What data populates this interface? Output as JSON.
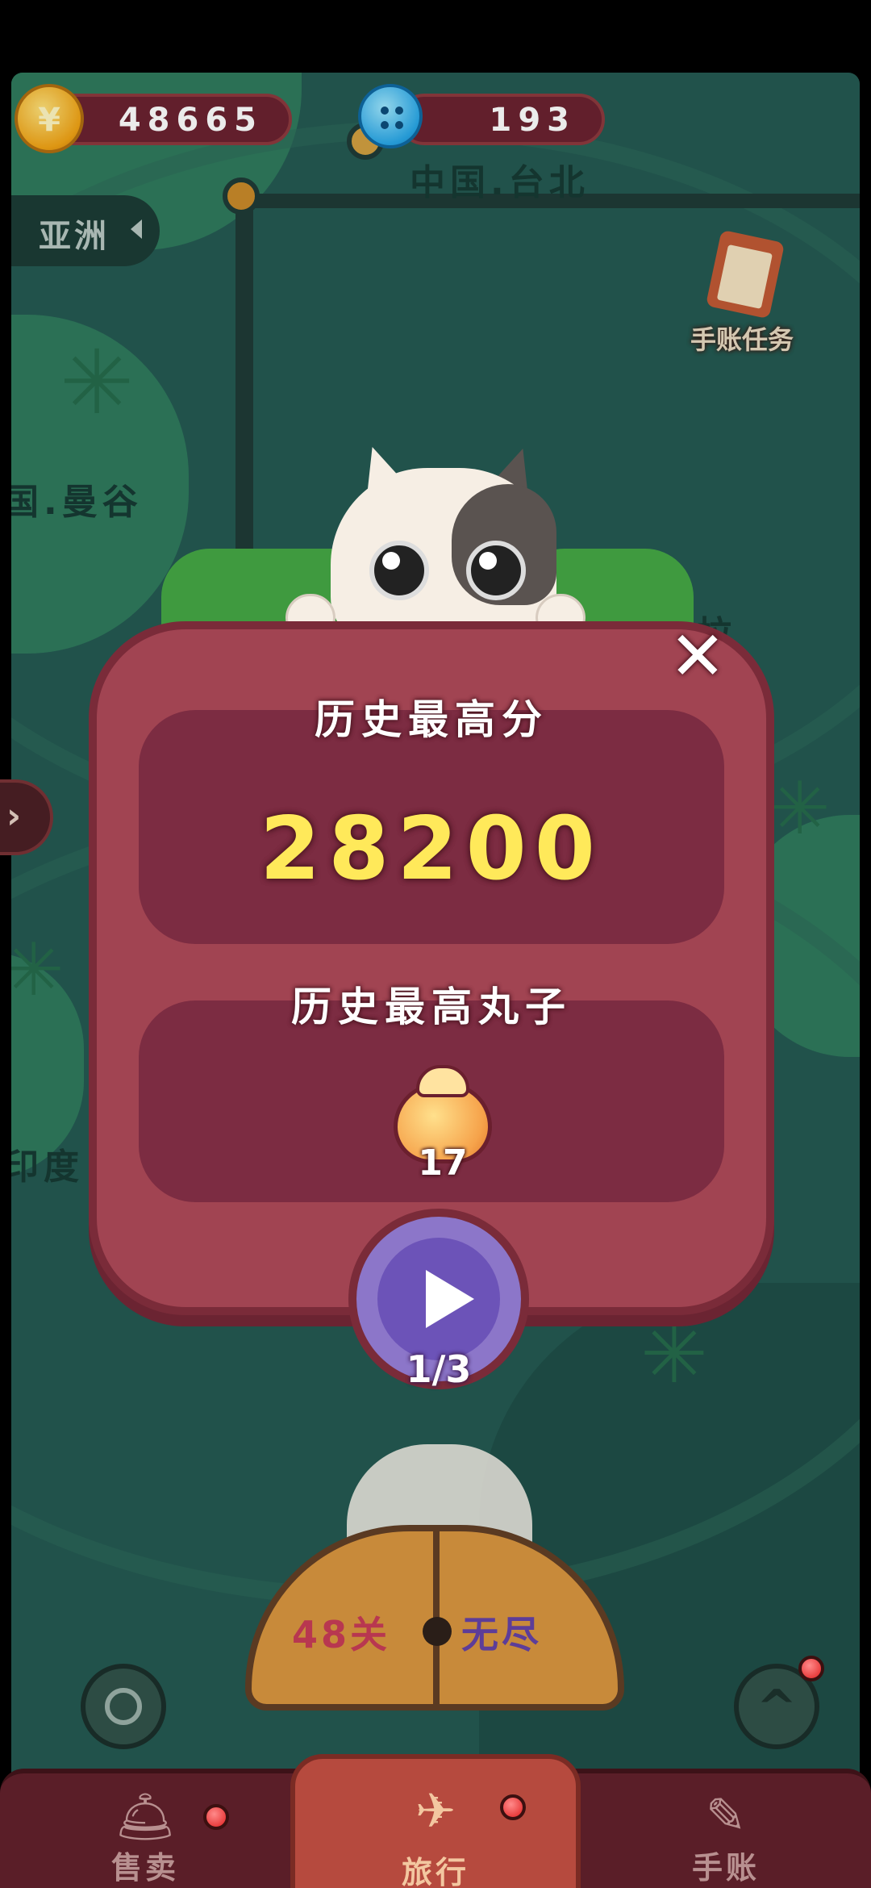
{
  "top_bar": {
    "coins": "48665",
    "buttons": "193"
  },
  "map": {
    "region": "亚洲",
    "labels": {
      "taipei": "中国.台北",
      "bangkok": "国.曼谷",
      "manila": "尼拉",
      "india": "印度"
    },
    "journal_task": "手账任务"
  },
  "modal": {
    "high_score_title": "历史最高分",
    "high_score": "28200",
    "high_dumpling_title": "历史最高丸子",
    "high_dumpling_count": "17",
    "plays": "1/3",
    "close_icon": "close-icon"
  },
  "mode_selector": {
    "level": "48关",
    "endless": "无尽"
  },
  "bottom_nav": {
    "items": [
      {
        "label": "售卖",
        "icon": "bell-icon"
      },
      {
        "label": "旅行",
        "icon": "travel-icon"
      },
      {
        "label": "手账",
        "icon": "journal-icon"
      }
    ]
  },
  "colors": {
    "map_sea": "#245a52",
    "modal_bg": "#a14452",
    "score_yellow": "#ffe95a",
    "play_purple": "#6c53b8"
  }
}
